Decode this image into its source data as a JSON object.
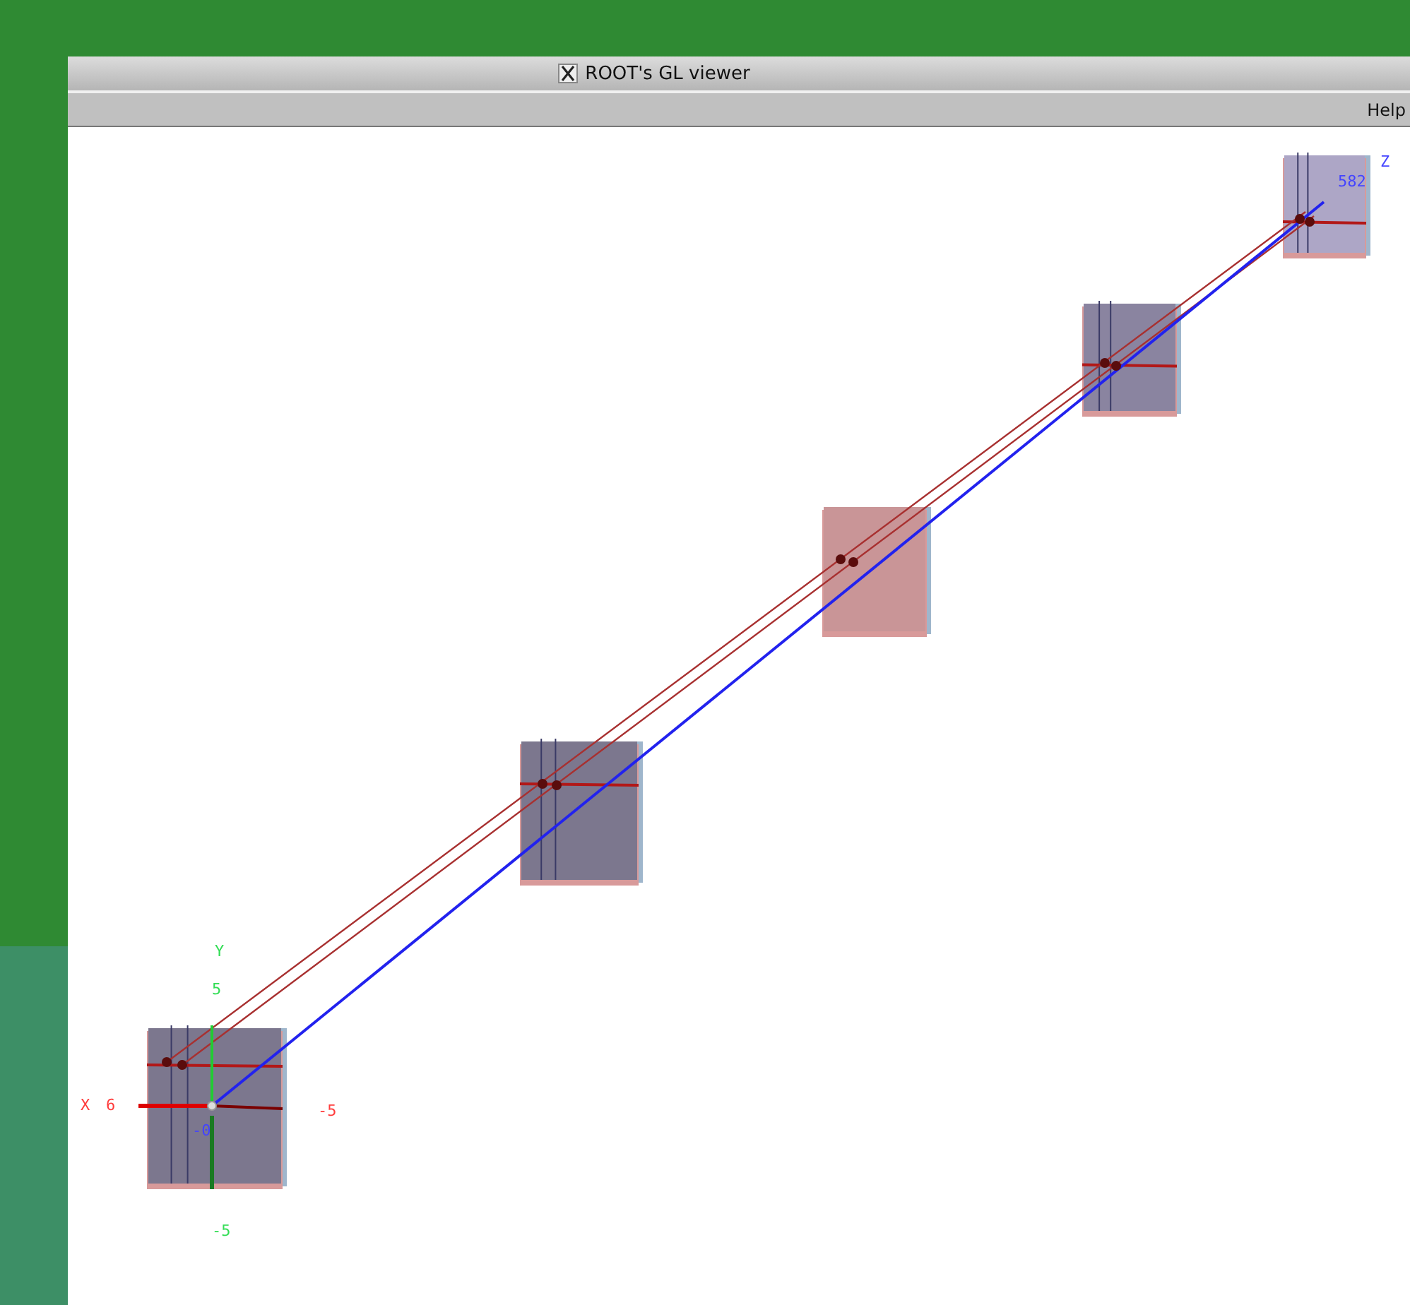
{
  "window": {
    "title": "ROOT's GL viewer"
  },
  "menu": [
    {
      "label": "Help"
    }
  ],
  "viewer": {
    "planes": [
      {
        "color": "#7c778e"
      },
      {
        "color": "#7c778e"
      },
      {
        "color": "#c99597"
      },
      {
        "color": "#8a84a0"
      },
      {
        "color": "#ada6c6"
      }
    ],
    "axis_labels": [
      {
        "kind": "y",
        "text": "Y"
      },
      {
        "kind": "y",
        "text": "5"
      },
      {
        "kind": "y",
        "text": "-5"
      },
      {
        "kind": "x",
        "text": "X"
      },
      {
        "kind": "x",
        "text": "6"
      },
      {
        "kind": "x",
        "text": "-5"
      },
      {
        "kind": "z",
        "text": "-0"
      },
      {
        "kind": "z",
        "text": "Z"
      },
      {
        "kind": "z",
        "text": "582"
      }
    ]
  }
}
